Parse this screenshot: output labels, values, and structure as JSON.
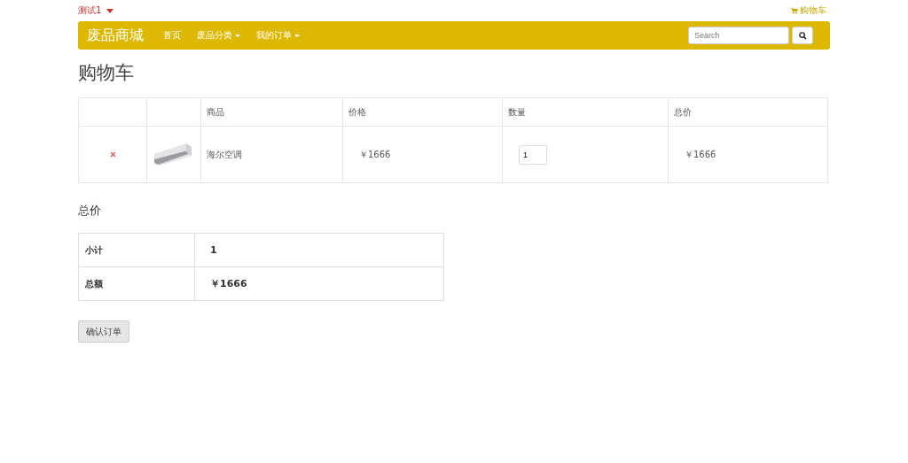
{
  "top_bar": {
    "user": "测试1",
    "cart_link": "购物车"
  },
  "navbar": {
    "brand": "废品商城",
    "items": [
      {
        "label": "首页",
        "dropdown": false
      },
      {
        "label": "废品分类",
        "dropdown": true
      },
      {
        "label": "我的订单",
        "dropdown": true
      }
    ],
    "search": {
      "placeholder": "Search"
    }
  },
  "page_title": "购物车",
  "cart_table": {
    "columns": [
      "商品",
      "价格",
      "数量",
      "总价"
    ],
    "rows": [
      {
        "name": "海尔空调",
        "price": "￥1666",
        "quantity": "1",
        "total": "￥1666"
      }
    ]
  },
  "summary": {
    "title": "总价",
    "rows": [
      {
        "label": "小计",
        "value": "1"
      },
      {
        "label": "总额",
        "value": "￥1666"
      }
    ]
  },
  "confirm_button": "确认订单"
}
